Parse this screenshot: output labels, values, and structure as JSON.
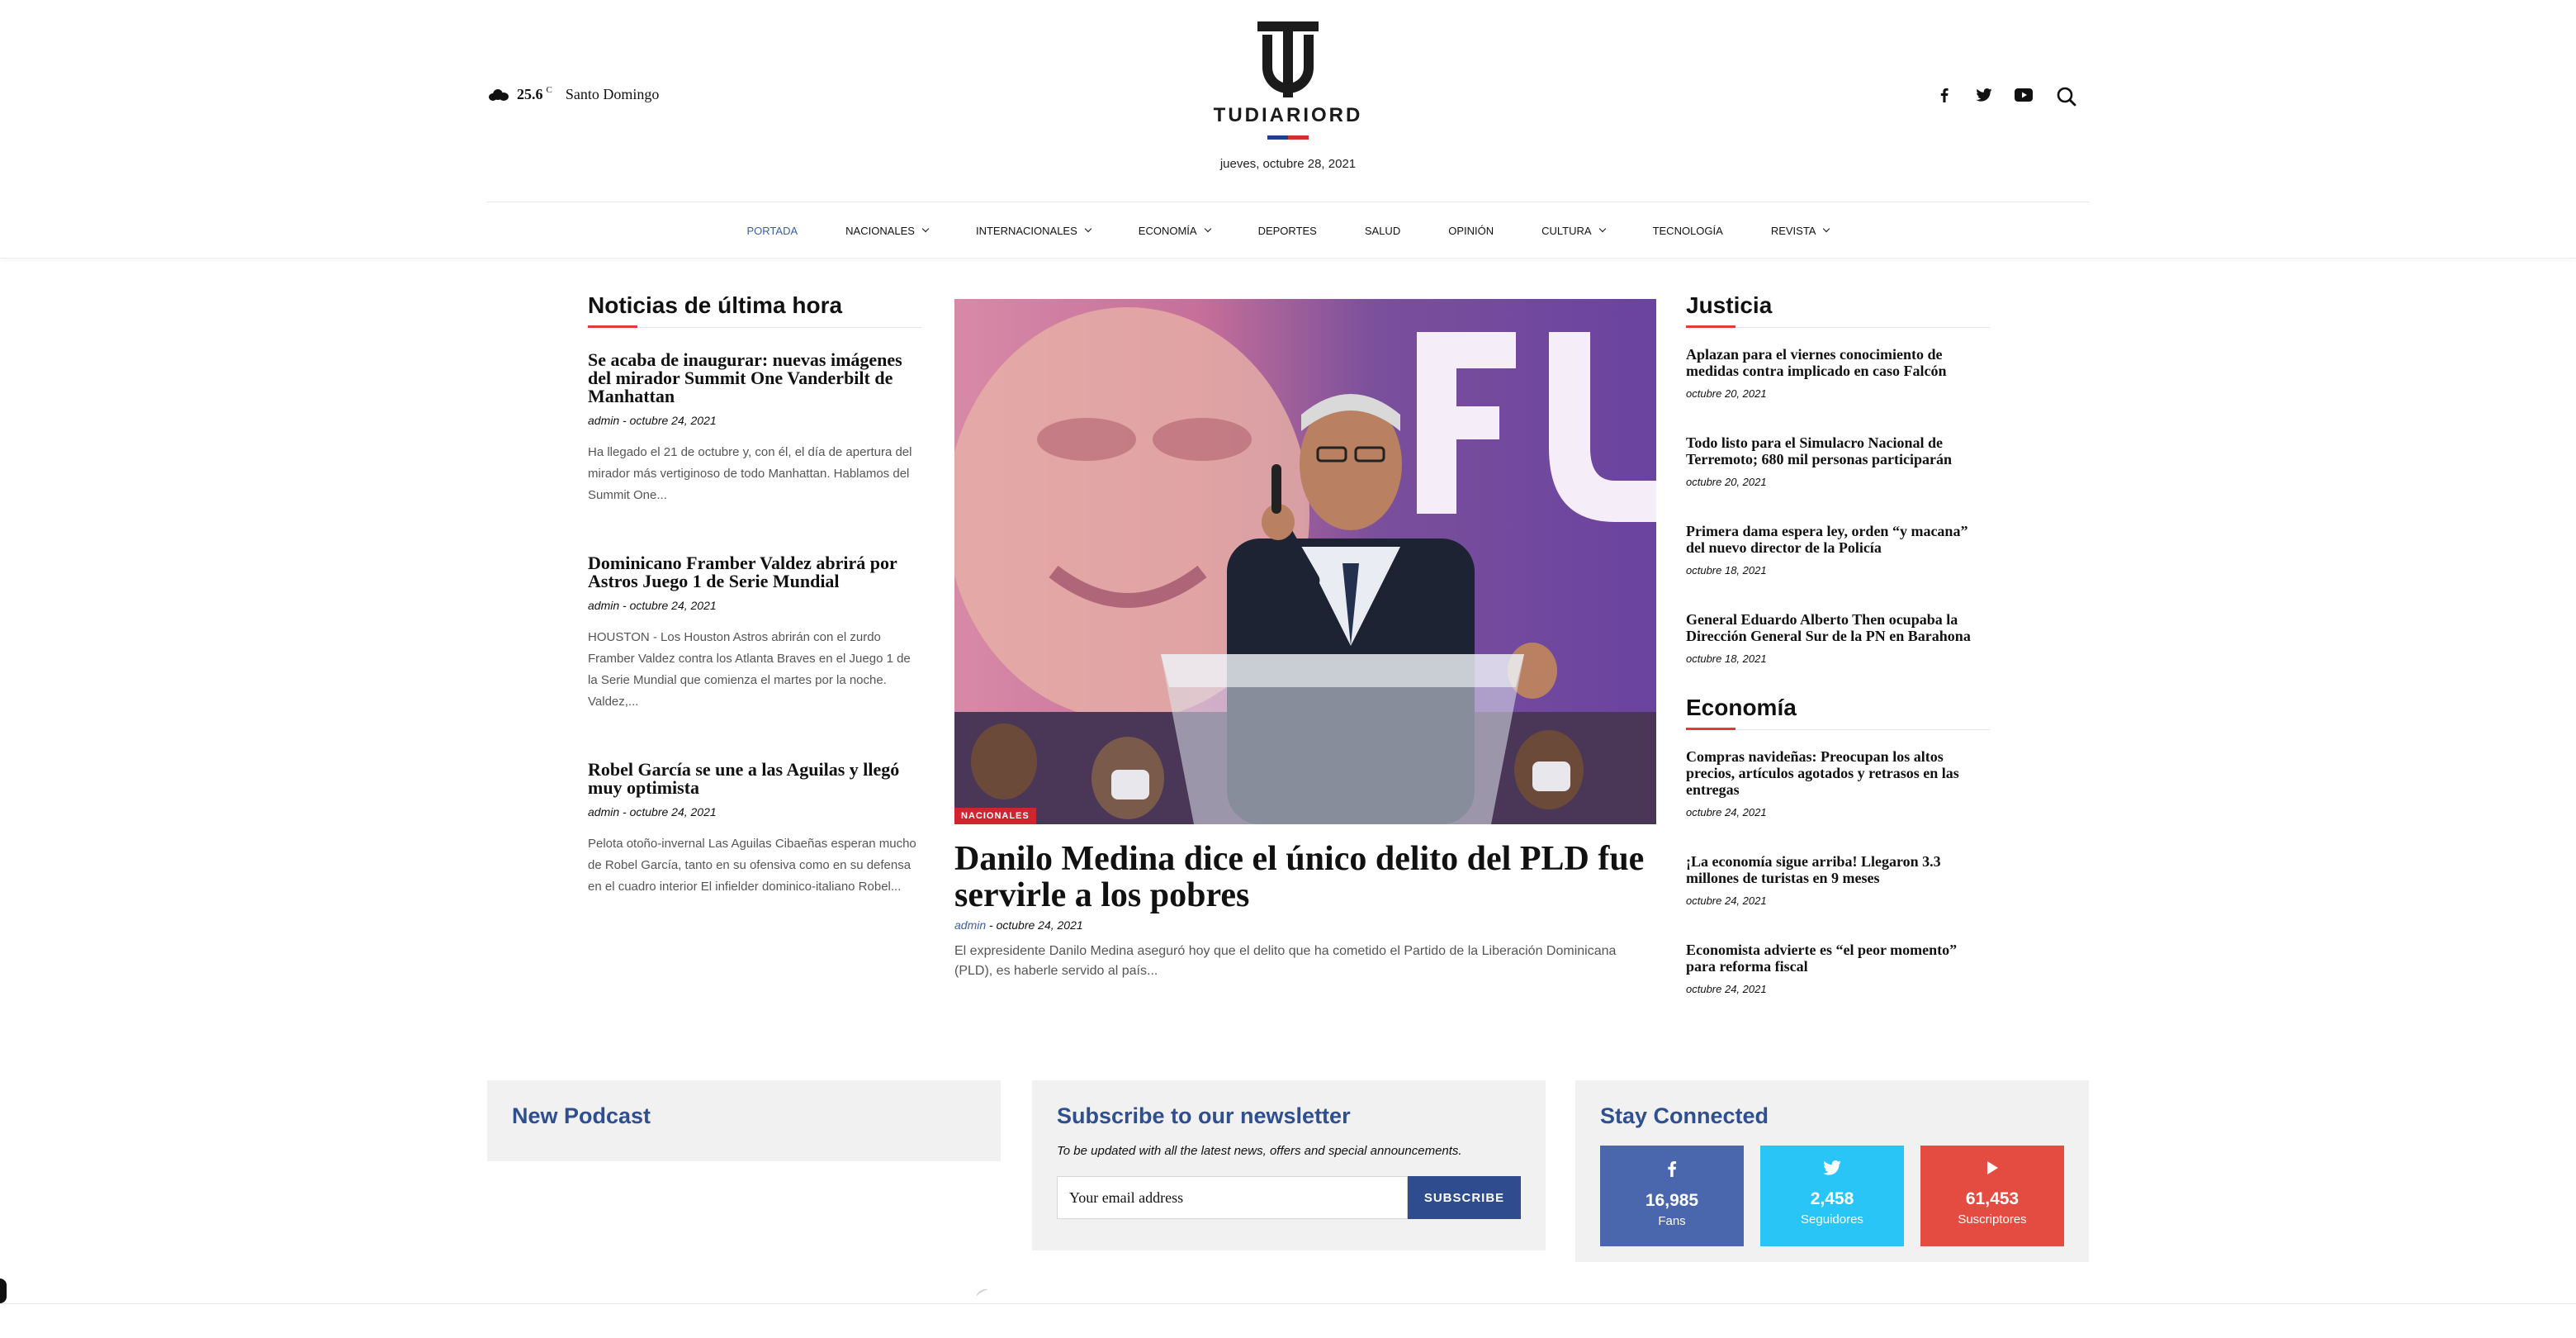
{
  "header": {
    "weather": {
      "temp": "25.6",
      "unit": "C",
      "city": "Santo Domingo",
      "icon": "cloud-icon"
    },
    "logo_text": "TUDIARIORD",
    "date": "jueves, octubre 28, 2021",
    "social_icons": [
      "facebook-icon",
      "twitter-icon",
      "youtube-icon"
    ],
    "search_icon": "search-icon"
  },
  "nav": {
    "items": [
      {
        "label": "PORTADA",
        "active": true,
        "dropdown": false
      },
      {
        "label": "NACIONALES",
        "active": false,
        "dropdown": true
      },
      {
        "label": "INTERNACIONALES",
        "active": false,
        "dropdown": true
      },
      {
        "label": "ECONOMÍA",
        "active": false,
        "dropdown": true
      },
      {
        "label": "DEPORTES",
        "active": false,
        "dropdown": false
      },
      {
        "label": "SALUD",
        "active": false,
        "dropdown": false
      },
      {
        "label": "OPINIÓN",
        "active": false,
        "dropdown": false
      },
      {
        "label": "CULTURA",
        "active": false,
        "dropdown": true
      },
      {
        "label": "TECNOLOGÍA",
        "active": false,
        "dropdown": false
      },
      {
        "label": "REVISTA",
        "active": false,
        "dropdown": true
      }
    ]
  },
  "left": {
    "title": "Noticias de última hora",
    "items": [
      {
        "title": "Se acaba de inaugurar: nuevas imágenes del mirador Summit One Vanderbilt de Manhattan",
        "author": "admin",
        "date": "- octubre 24, 2021",
        "excerpt": "Ha llegado el 21 de octubre y, con él, el día de apertura del mirador más vertiginoso de todo Manhattan. Hablamos del Summit One..."
      },
      {
        "title": "Dominicano Framber Valdez abrirá por Astros Juego 1 de Serie Mundial",
        "author": "admin",
        "date": "- octubre 24, 2021",
        "excerpt": "HOUSTON - Los Houston Astros abrirán con el zurdo Framber Valdez contra los Atlanta Braves en el Juego 1 de la Serie Mundial que comienza el martes por la noche. Valdez,..."
      },
      {
        "title": "Robel García se une a las Aguilas y llegó muy optimista",
        "author": "admin",
        "date": "- octubre 24, 2021",
        "excerpt": "Pelota otoño-invernal Las Aguilas Cibaeñas esperan mucho de Robel García, tanto en su ofensiva como en su defensa en el cuadro interior El infielder dominico-italiano Robel..."
      }
    ]
  },
  "feature": {
    "category": "NACIONALES",
    "title": "Danilo Medina dice el único delito del PLD fue servirle a los pobres",
    "author": "admin",
    "date": "- octubre 24, 2021",
    "excerpt": "El expresidente Danilo Medina aseguró hoy que el delito que ha cometido el Partido de la Liberación Dominicana (PLD), es haberle servido al país..."
  },
  "right": {
    "justicia": {
      "title": "Justicia",
      "items": [
        {
          "title": "Aplazan para el viernes conocimiento de medidas contra implicado en caso Falcón",
          "date": "octubre 20, 2021"
        },
        {
          "title": "Todo listo para el Simulacro Nacional de Terremoto; 680 mil personas participarán",
          "date": "octubre 20, 2021"
        },
        {
          "title": "Primera dama espera ley, orden “y macana” del nuevo director de la Policía",
          "date": "octubre 18, 2021"
        },
        {
          "title": "General Eduardo Alberto Then ocupaba la Dirección General Sur de la PN en Barahona",
          "date": "octubre 18, 2021"
        }
      ]
    },
    "economia": {
      "title": "Economía",
      "items": [
        {
          "title": "Compras navideñas: Preocupan los altos precios, artículos agotados y retrasos en las entregas",
          "date": "octubre 24, 2021"
        },
        {
          "title": "¡La economía sigue arriba! Llegaron 3.3 millones de turistas en 9 meses",
          "date": "octubre 24, 2021"
        },
        {
          "title": "Economista advierte es “el peor momento” para reforma fiscal",
          "date": "octubre 24, 2021"
        }
      ]
    }
  },
  "widgets": {
    "podcast": {
      "title": "New Podcast"
    },
    "newsletter": {
      "title": "Subscribe to our newsletter",
      "subtitle": "To be updated with all the latest news, offers and special announcements.",
      "placeholder": "Your email address",
      "button": "SUBSCRIBE"
    },
    "connect": {
      "title": "Stay Connected",
      "boxes": [
        {
          "icon": "facebook-icon",
          "count": "16,985",
          "label": "Fans",
          "color": "#4a67ad"
        },
        {
          "icon": "twitter-icon",
          "count": "2,458",
          "label": "Seguidores",
          "color": "#29c5f6"
        },
        {
          "icon": "youtube-icon",
          "count": "61,453",
          "label": "Suscriptores",
          "color": "#e44c41"
        }
      ]
    }
  },
  "colors": {
    "accent_blue": "#2f4f8f",
    "nav_active": "#3a5ea8",
    "accent_red": "#e23a36",
    "badge_red": "#d0252e"
  }
}
